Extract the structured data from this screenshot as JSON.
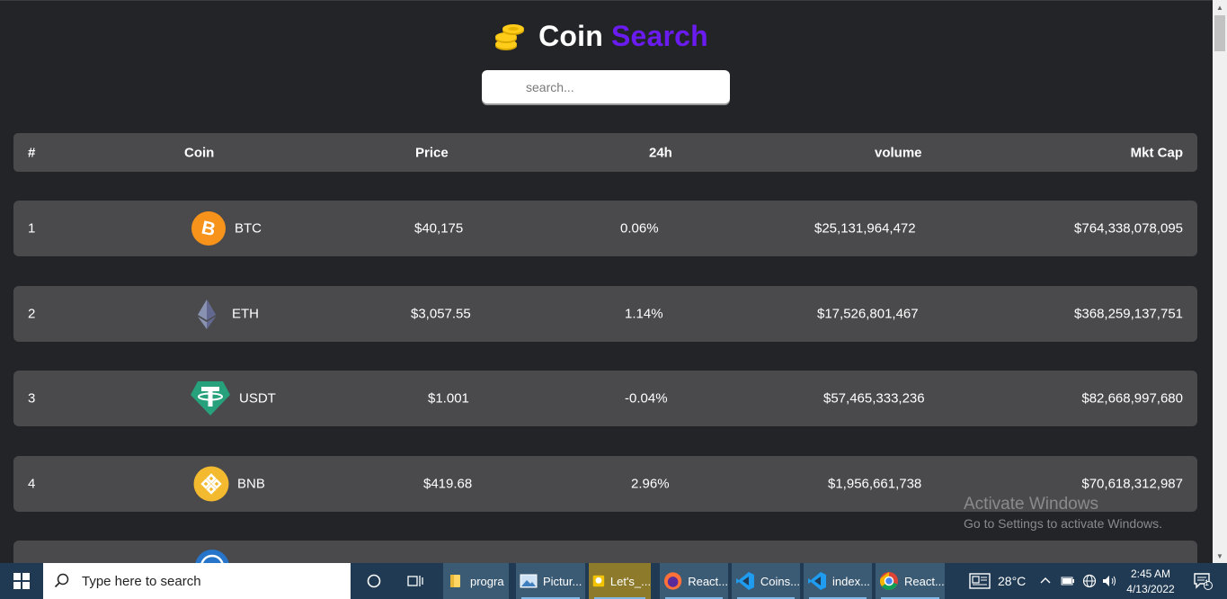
{
  "app": {
    "title_part1": "Coin",
    "title_part2": "Search",
    "accent_color": "#6a1bf0",
    "logo_icon": "coins-stack-icon"
  },
  "search": {
    "placeholder": "search...",
    "value": ""
  },
  "table": {
    "headers": {
      "rank": "#",
      "coin": "Coin",
      "price": "Price",
      "change": "24h",
      "volume": "volume",
      "mkt_cap": "Mkt Cap"
    },
    "rows": [
      {
        "rank": "1",
        "symbol": "BTC",
        "icon": "bitcoin-icon",
        "price": "$40,175",
        "change": "0.06%",
        "volume": "$25,131,964,472",
        "mkt_cap": "$764,338,078,095"
      },
      {
        "rank": "2",
        "symbol": "ETH",
        "icon": "ethereum-icon",
        "price": "$3,057.55",
        "change": "1.14%",
        "volume": "$17,526,801,467",
        "mkt_cap": "$368,259,137,751"
      },
      {
        "rank": "3",
        "symbol": "USDT",
        "icon": "tether-icon",
        "price": "$1.001",
        "change": "-0.04%",
        "volume": "$57,465,333,236",
        "mkt_cap": "$82,668,997,680"
      },
      {
        "rank": "4",
        "symbol": "BNB",
        "icon": "bnb-icon",
        "price": "$419.68",
        "change": "2.96%",
        "volume": "$1,956,661,738",
        "mkt_cap": "$70,618,312,987"
      }
    ]
  },
  "watermark": {
    "line1": "Activate Windows",
    "line2": "Go to Settings to activate Windows."
  },
  "taskbar": {
    "search_placeholder": "Type here to search",
    "items": [
      {
        "label": "progra",
        "icon": "folder-icon"
      },
      {
        "label": "Pictur...",
        "icon": "photos-icon"
      },
      {
        "label": "Let's_...",
        "icon": "app-icon"
      },
      {
        "label": "React...",
        "icon": "firefox-icon"
      },
      {
        "label": "Coins...",
        "icon": "vscode-icon"
      },
      {
        "label": "index...",
        "icon": "vscode-icon"
      },
      {
        "label": "React...",
        "icon": "chrome-icon"
      }
    ],
    "weather": "28°C",
    "time": "2:45 AM",
    "date": "4/13/2022",
    "notification_count": "1"
  }
}
